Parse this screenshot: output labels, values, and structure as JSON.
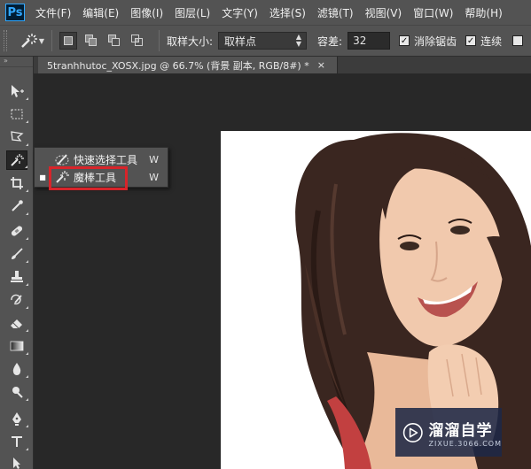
{
  "app": {
    "logo": "Ps"
  },
  "menu": [
    "文件(F)",
    "编辑(E)",
    "图像(I)",
    "图层(L)",
    "文字(Y)",
    "选择(S)",
    "滤镜(T)",
    "视图(V)",
    "窗口(W)",
    "帮助(H)"
  ],
  "options": {
    "sample_size_label": "取样大小:",
    "sample_size_value": "取样点",
    "tolerance_label": "容差:",
    "tolerance_value": "32",
    "antialias_label": "消除锯齿",
    "contiguous_label": "连续",
    "antialias_checked": true,
    "contiguous_checked": true
  },
  "document": {
    "tab_title": "5tranhhutoc_XOSX.jpg @ 66.7% (背景 副本, RGB/8#) *",
    "close_glyph": "×"
  },
  "flyout": {
    "items": [
      {
        "label": "快速选择工具",
        "shortcut": "W",
        "selected": false,
        "icon": "quick-selection-icon"
      },
      {
        "label": "魔棒工具",
        "shortcut": "W",
        "selected": true,
        "icon": "magic-wand-icon"
      }
    ],
    "highlight_color": "#d8242a"
  },
  "watermark": {
    "title": "溜溜自学",
    "subtitle": "ZIXUE.3066.COM"
  },
  "colors": {
    "panel": "#535353",
    "workspace": "#282828",
    "accent": "#31a8ff"
  }
}
